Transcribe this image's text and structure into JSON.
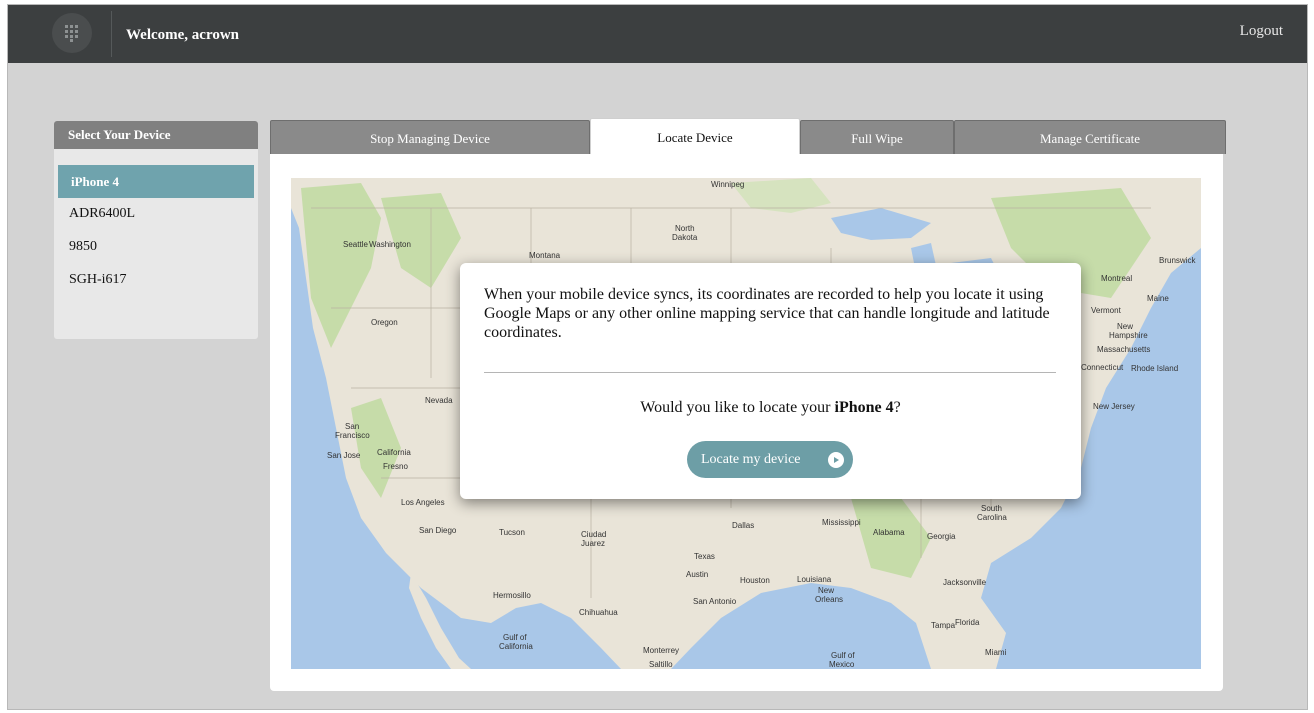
{
  "header": {
    "welcome": "Welcome, acrown",
    "logout": "Logout",
    "logo_icon": "grid-logo-icon"
  },
  "sidebar": {
    "title": "Select Your Device",
    "items": [
      {
        "label": "iPhone 4",
        "selected": true
      },
      {
        "label": "ADR6400L",
        "selected": false
      },
      {
        "label": "9850",
        "selected": false
      },
      {
        "label": "SGH-i617",
        "selected": false
      }
    ]
  },
  "tabs": [
    {
      "label": "Stop Managing Device",
      "active": false
    },
    {
      "label": "Locate Device",
      "active": true
    },
    {
      "label": "Full Wipe",
      "active": false
    },
    {
      "label": "Manage Certificate",
      "active": false
    }
  ],
  "map": {
    "labels": [
      "Winnipeg",
      "Seattle",
      "Washington",
      "Montana",
      "North",
      "Dakota",
      "Oregon",
      "Nevada",
      "San",
      "Francisco",
      "San Jose",
      "California",
      "Fresno",
      "Los Angeles",
      "San Diego",
      "Tucson",
      "Ciudad",
      "Juarez",
      "Chihuahua",
      "Hermosillo",
      "Texas",
      "Austin",
      "Houston",
      "San Antonio",
      "Dallas",
      "Louisiana",
      "New",
      "Orleans",
      "Mississippi",
      "Alabama",
      "Georgia",
      "South",
      "Carolina",
      "Jacksonville",
      "Florida",
      "Tampa",
      "Miami",
      "Gulf of",
      "Mexico",
      "Gulf of",
      "California",
      "Monterrey",
      "Saltillo",
      "Vermont",
      "Maine",
      "New",
      "Hampshire",
      "Massachusetts",
      "Connecticut",
      "Rhode Island",
      "New Jersey",
      "Montreal",
      "Brunswick"
    ],
    "colors": {
      "water": "#a9c7e8",
      "land": "#e9e4d8",
      "green": "#c6dca9"
    }
  },
  "dialog": {
    "text": "When your mobile device syncs, its coordinates are recorded to help you locate it using Google Maps or any other online mapping service that can handle longitude and latitude coordinates.",
    "question_prefix": "Would you like to locate your ",
    "question_device": "iPhone 4",
    "question_suffix": "?",
    "button_label": "Locate my device",
    "button_icon": "play-circle-icon"
  },
  "colors": {
    "topbar": "#3c3f40",
    "accent": "#6fa3ad",
    "tab": "#8a8a8a",
    "background": "#d3d3d3"
  }
}
